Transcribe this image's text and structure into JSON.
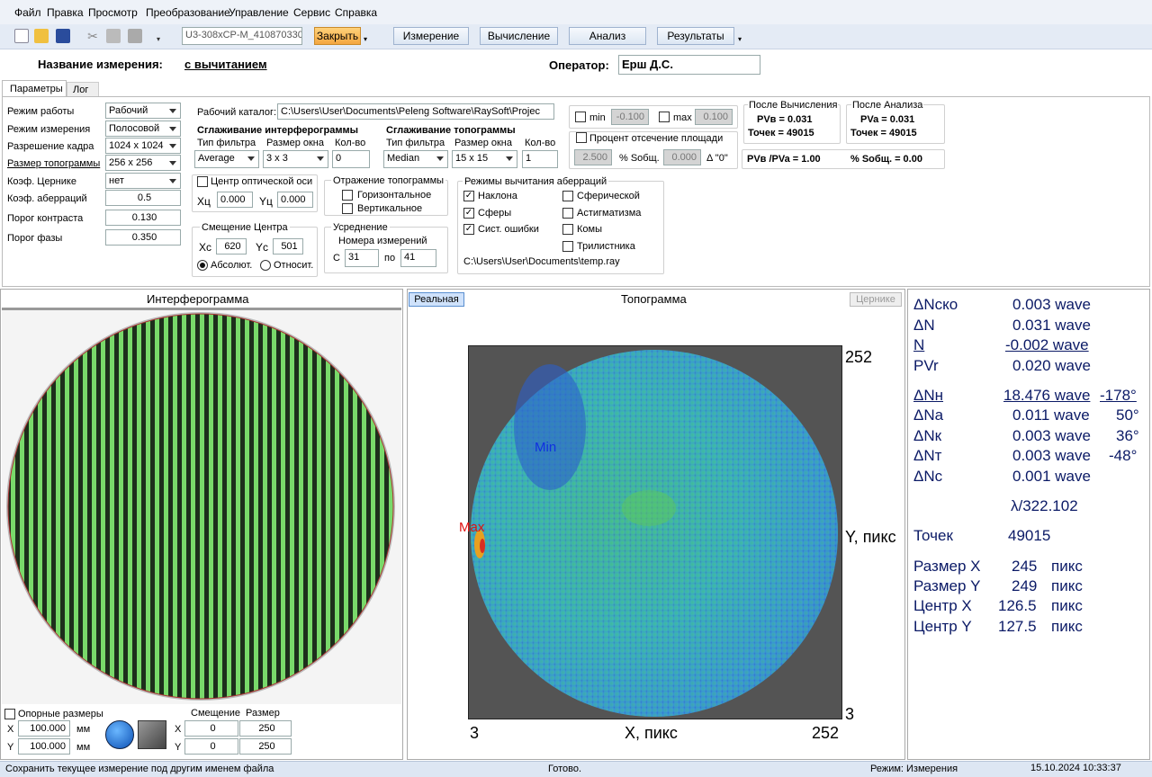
{
  "menu": [
    "Файл",
    "Правка",
    "Просмотр",
    "Преобразование",
    "Управление",
    "Сервис",
    "Справка"
  ],
  "toolbar": {
    "combo": "U3-308xCP-M_4108703305",
    "close": "Закрыть",
    "buttons": [
      "Измерение",
      "Вычисление",
      "Анализ",
      "Результаты"
    ]
  },
  "header": {
    "name_label": "Название измерения:",
    "name_value": "с вычитанием",
    "operator_label": "Оператор:",
    "operator_value": "Ерш Д.С."
  },
  "tabs": [
    "Параметры",
    "Лог"
  ],
  "params": [
    {
      "label": "Режим работы",
      "value": "Рабочий"
    },
    {
      "label": "Режим измерения",
      "value": "Полосовой"
    },
    {
      "label": "Разрешение кадра",
      "value": "1024 x 1024"
    },
    {
      "label": "Размер топограммы",
      "value": "256 x 256"
    },
    {
      "label": "Коэф. Цернике",
      "value": "нет"
    },
    {
      "label": "Коэф. аберраций",
      "value": "0.5"
    },
    {
      "label": "Порог контраста",
      "value": "0.130"
    },
    {
      "label": "Порог фазы",
      "value": "0.350"
    }
  ],
  "workdir": {
    "label": "Рабочий каталог:",
    "value": "C:\\Users\\User\\Documents\\Peleng Software\\RaySoft\\Projec"
  },
  "smooth_int": {
    "title": "Сглаживание интерферограммы",
    "filter_label": "Тип фильтра",
    "window_label": "Размер окна",
    "count_label": "Кол-во",
    "filter": "Average",
    "window": "3 x 3",
    "count": "0"
  },
  "smooth_topo": {
    "title": "Сглаживание топограммы",
    "filter_label": "Тип фильтра",
    "window_label": "Размер окна",
    "count_label": "Кол-во",
    "filter": "Median",
    "window": "15 x 15",
    "count": "1"
  },
  "optical_axis": {
    "label": "Центр оптической оси",
    "xc_label": "Xц",
    "xc": "0.000",
    "yc_label": "Yц",
    "yc": "0.000"
  },
  "center_shift": {
    "title": "Смещение Центра",
    "xc_label": "Xc",
    "xc": "620",
    "yc_label": "Yc",
    "yc": "501",
    "abs": "Абсолют.",
    "rel": "Относит."
  },
  "reflect": {
    "title": "Отражение топограммы",
    "h": "Горизонтальное",
    "v": "Вертикальное"
  },
  "averaging": {
    "title": "Усреднение",
    "sub": "Номера измерений",
    "from_label": "С",
    "from": "31",
    "to_label": "по",
    "to": "41"
  },
  "aberr": {
    "title": "Режимы вычитания аберраций",
    "items": [
      {
        "label": "Наклона",
        "on": true
      },
      {
        "label": "Сферы",
        "on": true
      },
      {
        "label": "Сист. ошибки",
        "on": true
      }
    ],
    "items2": [
      "Сферической",
      "Астигматизма",
      "Комы",
      "Трилистника"
    ],
    "path": "C:\\Users\\User\\Documents\\temp.ray"
  },
  "minmax": {
    "min_label": "min",
    "min": "-0.100",
    "max_label": "max",
    "max": "0.100"
  },
  "cut": {
    "label": "Процент отсечение площади",
    "v1": "2.500",
    "s_label": "% Sобщ.",
    "v2": "0.000",
    "d_label": "Δ  \"0\""
  },
  "after_calc": {
    "title": "После Вычисления",
    "pv": "PVв = 0.031",
    "pts": "Точек = 49015"
  },
  "after_anal": {
    "title": "После Анализа",
    "pv": "PVa = 0.031",
    "pts": "Точек = 49015"
  },
  "ratio": {
    "pv": "PVв /PVa = 1.00",
    "s": "% Sобщ. = 0.00"
  },
  "interferogram": {
    "title": "Интерферограмма",
    "ref_label": "Опорные размеры",
    "x_label": "X",
    "x_val": "100.000",
    "y_label": "Y",
    "y_val": "100.000",
    "unit": "мм",
    "shift_label": "Смещение",
    "size_label": "Размер",
    "sx": "0",
    "sy": "0",
    "wx": "250",
    "wy": "250"
  },
  "topogram": {
    "title": "Топограмма",
    "real_btn": "Реальная",
    "zernike_btn": "Цернике",
    "y_max": "252",
    "y_min": "3",
    "x_min": "3",
    "x_max": "252",
    "y_axis": "Y, пикс",
    "x_axis": "X, пикс",
    "min_label": "Min",
    "max_label": "Max"
  },
  "results": [
    {
      "label": "ΔNско",
      "value": "0.003 wave",
      "extra": ""
    },
    {
      "label": "ΔN",
      "value": "0.031 wave",
      "extra": ""
    },
    {
      "label": "N",
      "value": "-0.002 wave",
      "extra": ""
    },
    {
      "label": "PVr",
      "value": "0.020 wave",
      "extra": ""
    },
    {
      "label": "ΔNн",
      "value": "18.476 wave",
      "extra": "-178°"
    },
    {
      "label": "ΔNa",
      "value": "0.011 wave",
      "extra": "50°"
    },
    {
      "label": "ΔNк",
      "value": "0.003 wave",
      "extra": "36°"
    },
    {
      "label": "ΔNт",
      "value": "0.003 wave",
      "extra": "-48°"
    },
    {
      "label": "ΔNc",
      "value": "0.001 wave",
      "extra": ""
    }
  ],
  "lambda": "λ/322.102",
  "points": {
    "label": "Точек",
    "value": "49015"
  },
  "sizes": [
    {
      "label": "Размер X",
      "value": "245",
      "unit": "пикс"
    },
    {
      "label": "Размер Y",
      "value": "249",
      "unit": "пикс"
    },
    {
      "label": "Центр X",
      "value": "126.5",
      "unit": "пикс"
    },
    {
      "label": "Центр Y",
      "value": "127.5",
      "unit": "пикс"
    }
  ],
  "status": {
    "hint": "Сохранить текущее измерение под другим именем файла",
    "state": "Готово.",
    "mode": "Режим: Измерения",
    "date": "15.10.2024",
    "time": "10:33:37"
  }
}
